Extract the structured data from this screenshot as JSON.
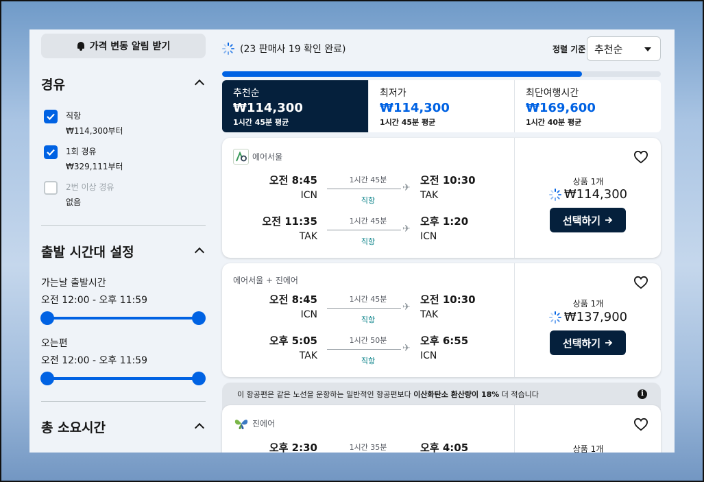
{
  "sidebar": {
    "alert_button": "가격 변동 알림 받기",
    "stops": {
      "title": "경유",
      "options": [
        {
          "label": "직항",
          "sub": "₩114,300부터",
          "checked": true,
          "disabled": false
        },
        {
          "label": "1회 경유",
          "sub": "₩329,111부터",
          "checked": true,
          "disabled": false
        },
        {
          "label": "2번 이상 경유",
          "sub": "없음",
          "checked": false,
          "disabled": true
        }
      ]
    },
    "departure_times": {
      "title": "출발 시간대 설정",
      "outbound_label": "가는날 출발시간",
      "outbound_range": "오전 12:00 - 오후 11:59",
      "return_label": "오는편",
      "return_range": "오전 12:00 - 오후 11:59"
    },
    "duration": {
      "title": "총 소요시간"
    }
  },
  "main": {
    "status": "(23 판매사 19 확인 완료)",
    "progress": 0.82,
    "sort": {
      "label": "정렬 기준",
      "value": "추천순"
    },
    "tabs": [
      {
        "name": "추천순",
        "price": "₩114,300",
        "sub": "1시간 45분 평균",
        "active": true
      },
      {
        "name": "최저가",
        "price": "₩114,300",
        "sub": "1시간 45분 평균",
        "active": false
      },
      {
        "name": "최단여행시간",
        "price": "₩169,600",
        "sub": "1시간 40분 평균",
        "active": false
      }
    ],
    "results": [
      {
        "airline": "에어서울",
        "legs": [
          {
            "dep_time": "오전 8:45",
            "dep_code": "ICN",
            "duration": "1시간 45분",
            "stops": "직항",
            "arr_time": "오전 10:30",
            "arr_code": "TAK"
          },
          {
            "dep_time": "오전 11:35",
            "dep_code": "TAK",
            "duration": "1시간 45분",
            "stops": "직항",
            "arr_time": "오후 1:20",
            "arr_code": "ICN"
          }
        ],
        "deals": "상품 1개",
        "price": "₩114,300",
        "button": "선택하기"
      },
      {
        "airline": "에어서울 + 진에어",
        "legs": [
          {
            "dep_time": "오전 8:45",
            "dep_code": "ICN",
            "duration": "1시간 45분",
            "stops": "직항",
            "arr_time": "오전 10:30",
            "arr_code": "TAK"
          },
          {
            "dep_time": "오후 5:05",
            "dep_code": "TAK",
            "duration": "1시간 50분",
            "stops": "직항",
            "arr_time": "오후 6:55",
            "arr_code": "ICN"
          }
        ],
        "deals": "상품 1개",
        "price": "₩137,900",
        "button": "선택하기"
      },
      {
        "airline": "진에어",
        "legs": [
          {
            "dep_time": "오후 2:30",
            "duration": "1시간 35분",
            "arr_time": "오후 4:05"
          }
        ],
        "deals": "상품 1개"
      }
    ],
    "eco_banner": {
      "prefix": "이 항공편은 같은 노선을 운항하는 일반적인 항공편보다 ",
      "bold": "이산화탄소 환산량이 18%",
      "suffix": " 더 적습니다"
    }
  },
  "colors": {
    "accent": "#0062e3",
    "dark": "#05203c",
    "direct": "#0c838a",
    "background": "#eff3f8"
  },
  "icons": [
    "bell-icon",
    "chevron-up-icon",
    "checkmark-icon",
    "spinner-icon",
    "caret-down-icon",
    "plane-icon",
    "heart-icon",
    "arrow-right-icon",
    "info-icon"
  ]
}
